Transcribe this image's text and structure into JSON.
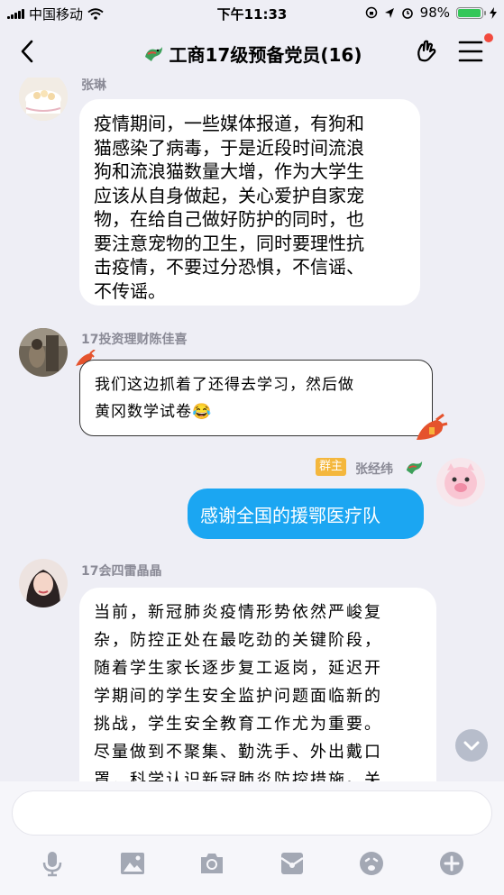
{
  "status_bar": {
    "carrier": "中国移动",
    "time": "下午11:33",
    "battery_percent": "98%",
    "battery_level": 0.98,
    "accent_color": "#34C759"
  },
  "header": {
    "title": "工商17级预备党员(16)",
    "back_icon": "chevron-left-icon",
    "gesture_icon": "hand-gesture-icon",
    "menu_icon": "menu-icon",
    "notification_dot_color": "#F24A3E"
  },
  "messages": [
    {
      "sender": "张琳",
      "text": "疫情期间，一些媒体报道，有狗和猫感染了病毒，于是近段时间流浪狗和流浪猫数量大增，作为大学生应该从自身做起，关心爱护自家宠物，在给自己做好防护的同时，也要注意宠物的卫生，同时要理性抗击疫情，不要过分恐惧，不信谣、不传谣。",
      "lines": [
        "疫情期间，一些媒体报道，有狗和",
        "猫感染了病毒，于是近段时间流浪",
        "狗和流浪猫数量大增，作为大学生",
        "应该从自身做起，关心爱护自家宠",
        "物，在给自己做好防护的同时，也",
        "要注意宠物的卫生，同时要理性抗",
        "击疫情，不要过分恐惧，不信谣、",
        "不传谣。"
      ]
    },
    {
      "sender": "17投资理财陈佳喜",
      "text": "我们这边抓着了还得去学习，然后做黄冈数学试卷😂",
      "lines": [
        "我们这边抓着了还得去学习，然后做",
        "黄冈数学试卷😂"
      ]
    },
    {
      "sender": "张经纬",
      "role_badge": "群主",
      "text": "感谢全国的援鄂医疗队",
      "bubble_color": "#1BA6F2",
      "self": true
    },
    {
      "sender": "17会四雷晶晶",
      "text": "当前，新冠肺炎疫情形势依然严峻复杂，防控正处在最吃劲的关键阶段，随着学生家长逐步复工返岗，延迟开学期间的学生安全监护问题面临新的挑战，学生安全教育工作尤为重要。尽量做到不聚集、勤洗手、外出戴口罩，科学认识新冠肺炎防控措施。关",
      "lines": [
        "当前，新冠肺炎疫情形势依然严峻复",
        "杂，防控正处在最吃劲的关键阶段，",
        "随着学生家长逐步复工返岗，延迟开",
        "学期间的学生安全监护问题面临新的",
        "挑战，学生安全教育工作尤为重要。",
        "尽量做到不聚集、勤洗手、外出戴口",
        "罩，科学认识新冠肺炎防控措施。关"
      ]
    }
  ],
  "input": {
    "placeholder": "",
    "toolbar_icons": [
      "microphone-icon",
      "image-icon",
      "camera-icon",
      "red-packet-icon",
      "emoji-icon",
      "plus-icon"
    ]
  }
}
